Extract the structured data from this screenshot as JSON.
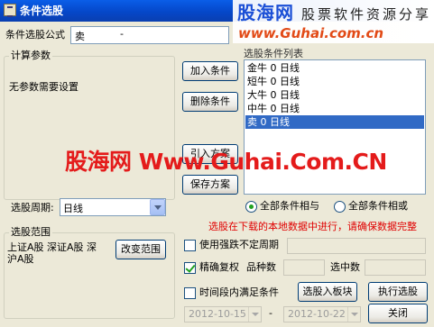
{
  "window": {
    "title": "条件选股"
  },
  "brand": {
    "name": "股海网",
    "slogan": "股票软件资源分享",
    "url": "www.Guhai.com.cn"
  },
  "formula": {
    "label": "条件选股公式",
    "value": "卖",
    "description": "-"
  },
  "params": {
    "legend": "计算参数",
    "empty_text": "无参数需要设置"
  },
  "period": {
    "label": "选股周期:",
    "value": "日线"
  },
  "range": {
    "legend": "选股范围",
    "text": "上证A股 深证A股 深沪A股",
    "button": "改变范围"
  },
  "buttons": {
    "add": "加入条件",
    "delete": "删除条件",
    "import": "引入方案",
    "save": "保存方案"
  },
  "conditions": {
    "header": "选股条件列表",
    "items": [
      "金牛  0  日线",
      "短牛  0  日线",
      "大牛  0  日线",
      "中牛  0  日线",
      "卖  0  日线"
    ],
    "selected_index": 4
  },
  "logic": {
    "and_label": "全部条件相与",
    "or_label": "全部条件相或",
    "selected": "and"
  },
  "notice": "选股在下载的本地数据中进行，请确保数据完整",
  "options": {
    "irregular_period": {
      "label": "使用强跌不定周期",
      "checked": false
    },
    "adjusted": {
      "label": "精确复权",
      "checked": true
    },
    "count_label": "品种数",
    "selected_label": "选中数",
    "time_range": {
      "label": "时间段内满足条件",
      "checked": false
    }
  },
  "dates": {
    "start": "2012-10-15",
    "separator": "-",
    "end": "2012-10-22"
  },
  "actions": {
    "board": "选股入板块",
    "run": "执行选股",
    "close": "关闭"
  },
  "watermark": "股海网 Www.Guhai.Com.CN",
  "colors": {
    "titlebar": "#0547c9",
    "selection": "#316ac5",
    "notice": "#e00000",
    "watermark": "#e41b1b"
  }
}
